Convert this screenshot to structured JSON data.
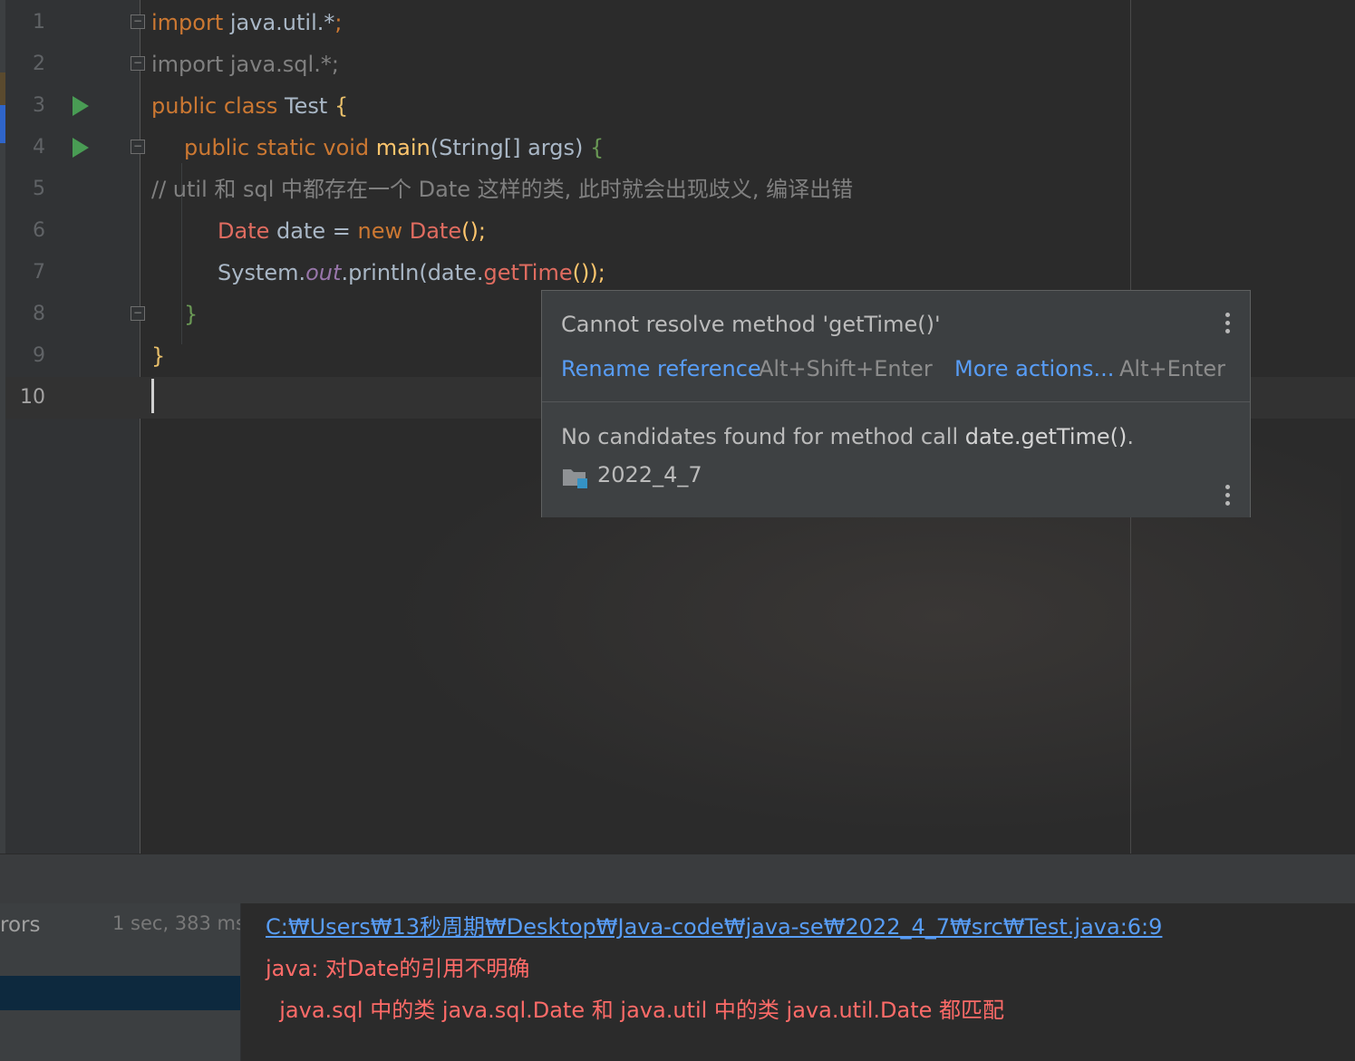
{
  "editor": {
    "line_numbers": [
      "1",
      "2",
      "3",
      "4",
      "5",
      "6",
      "7",
      "8",
      "9",
      "10"
    ],
    "current_line": "10",
    "lines": {
      "l1": {
        "kw": "import",
        "rest": " java.util.*",
        "semi": ";"
      },
      "l2": {
        "text": "import java.sql.*;"
      },
      "l3": {
        "kw": "public class",
        "name": " Test ",
        "brace": "{"
      },
      "l4": {
        "kw": "public static void",
        "fn": " main",
        "params": "(String[] args) ",
        "brace": "{"
      },
      "l5": {
        "comment": "// util 和 sql 中都存在一个 Date 这样的类, 此时就会出现歧义, 编译出错"
      },
      "l6": {
        "type": "Date",
        "var": " date ",
        "op": "=",
        "kw": " new",
        "ctor": " Date",
        "end": "();"
      },
      "l7": {
        "obj": "System.",
        "field": "out",
        "call": ".println(date.",
        "method": "getTime",
        "end": "());"
      },
      "l8": {
        "brace": "}"
      },
      "l9": {
        "brace": "}"
      }
    }
  },
  "popup": {
    "message": "Cannot resolve method 'getTime()'",
    "action1_label": "Rename reference",
    "action1_shortcut": "Alt+Shift+Enter",
    "action2_label": "More actions...",
    "action2_shortcut": "Alt+Enter",
    "detail_prefix": "No candidates found for method call ",
    "detail_code": "date.getTime()",
    "detail_suffix": ".",
    "module_name": "2022_4_7"
  },
  "build_panel": {
    "left_label": "rors",
    "duration": "1 sec, 383 ms",
    "error_path": "C:₩Users₩13秒周期₩Desktop₩Java-code₩java-se₩2022_4_7₩src₩Test.java:6:9",
    "error_line1": "java: 对Date的引用不明确",
    "error_line2": "  java.sql 中的类 java.sql.Date 和 java.util 中的类 java.util.Date 都匹配"
  },
  "colors": {
    "background": "#2b2b2b",
    "keyword": "#cc7832",
    "error_text": "#ff6b68",
    "link": "#589df6",
    "run_icon": "#499c54"
  },
  "icons": [
    "run-icon",
    "fold-icon",
    "kebab-menu-icon",
    "folder-icon"
  ]
}
